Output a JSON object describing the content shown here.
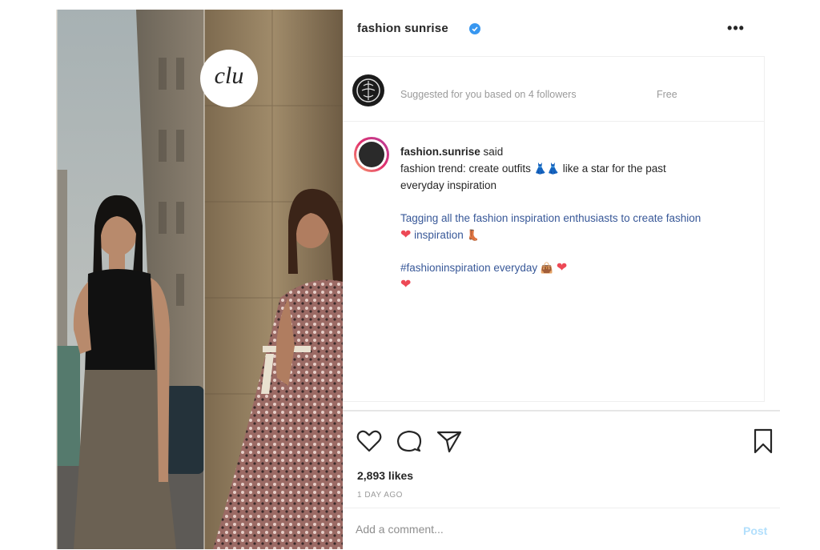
{
  "header": {
    "username": "fashion sunrise",
    "verified_icon": "verified-badge-icon",
    "more_label": "•••"
  },
  "suggestion": {
    "text": "Suggested for you based on 4 followers",
    "action": "Free"
  },
  "caption": {
    "username": "fashion.sunrise",
    "username_suffix": "said",
    "line1": "fashion trend: create outfits",
    "line1_emoji": "👗👗",
    "line1_rest": "like a star for the past",
    "line2": "everyday inspiration",
    "tags_line": "Tagging all the fashion inspiration enthusiasts to create fashion",
    "tags_line2": "inspiration",
    "tags_line2_emoji": "👢",
    "mention_line": "#fashioninspiration everyday",
    "mention_emoji": "👜",
    "heart": "❤"
  },
  "actions": {
    "like_icon": "heart-icon",
    "comment_icon": "comment-icon",
    "share_icon": "share-icon",
    "save_icon": "bookmark-icon"
  },
  "likes_text": "2,893 likes",
  "time_text": "1 DAY AGO",
  "comment": {
    "placeholder": "Add a comment...",
    "post_label": "Post"
  },
  "colors": {
    "link": "#385898",
    "verified": "#3897f0",
    "heart": "#ed4956",
    "post": "#b2dffc"
  },
  "photo": {
    "logo_text": "clu"
  }
}
